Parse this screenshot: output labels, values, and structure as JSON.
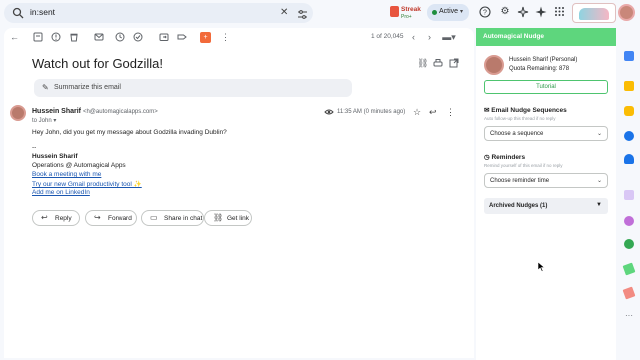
{
  "search": {
    "query": "in:sent"
  },
  "topbar": {
    "streak_name": "Streak",
    "streak_plan": "Pro+",
    "status_label": "Active"
  },
  "mail": {
    "page_count": "1 of 20,045",
    "subject": "Watch out for Godzilla!",
    "summarize_label": "Summarize this email",
    "sender_name": "Hussein Sharif",
    "sender_email": "<h@automagicalapps.com>",
    "recipient": "to John",
    "time": "11:35 AM (0 minutes ago)",
    "greeting": "Hey John, did you get my message about Godzilla invading Dublin?",
    "sig_dashes": "--",
    "sig_name": "Hussein Sharif",
    "sig_title": "Operations @ Automagical Apps",
    "sig_link1": "Book a meeting with me",
    "sig_link2": "Try our new Gmail productivity tool ✨",
    "sig_link3": "Add me on LinkedIn",
    "actions": {
      "reply": "Reply",
      "forward": "Forward",
      "share": "Share in chat",
      "getlink": "Get link"
    }
  },
  "nudge": {
    "header": "Automagical Nudge",
    "user_name": "Hussein Sharif (Personal)",
    "quota": "Quota Remaining: 878",
    "tutorial": "Tutorial",
    "sequences_title": "Email Nudge Sequences",
    "sequences_sub": "Auto follow-up this thread if no reply",
    "sequence_select": "Choose a sequence",
    "reminders_title": "Reminders",
    "reminders_sub": "Remind yourself of this email if no reply",
    "reminder_select": "Choose reminder time",
    "archived": "Archived Nudges (1)"
  },
  "colors": {
    "accent_green": "#5ed67d",
    "link_blue": "#1a56b0",
    "active_green": "#1e8e3e"
  }
}
